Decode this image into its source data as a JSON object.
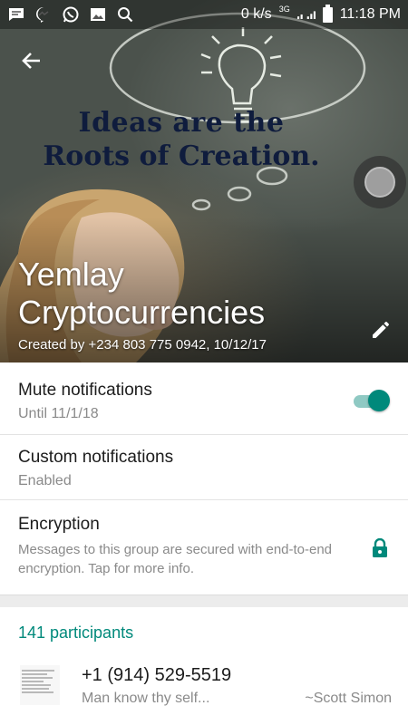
{
  "status_bar": {
    "speed": "0 k/s",
    "network": "3G",
    "time": "11:18 PM",
    "icons": [
      "message-icon",
      "messenger-icon",
      "whatsapp-icon",
      "gallery-icon",
      "search-icon"
    ]
  },
  "header": {
    "image_text_line1": "Ideas are the",
    "image_text_line2": "Roots of Creation.",
    "group_name": "Yemlay Cryptocurrencies",
    "created_by": "Created by +234 803 775 0942, 10/12/17"
  },
  "settings": {
    "mute": {
      "title": "Mute notifications",
      "subtitle": "Until 11/1/18",
      "enabled": true
    },
    "custom": {
      "title": "Custom notifications",
      "subtitle": "Enabled"
    },
    "encryption": {
      "title": "Encryption",
      "description": "Messages to this group are secured with end-to-end encryption. Tap for more info."
    }
  },
  "participants": {
    "count_label": "141 participants",
    "list": [
      {
        "name": "+1 (914) 529-5519",
        "status": "Man know thy self...",
        "pushname": "~Scott Simon"
      }
    ]
  },
  "colors": {
    "accent": "#00897b",
    "toggle_track": "#8fc9c3"
  }
}
